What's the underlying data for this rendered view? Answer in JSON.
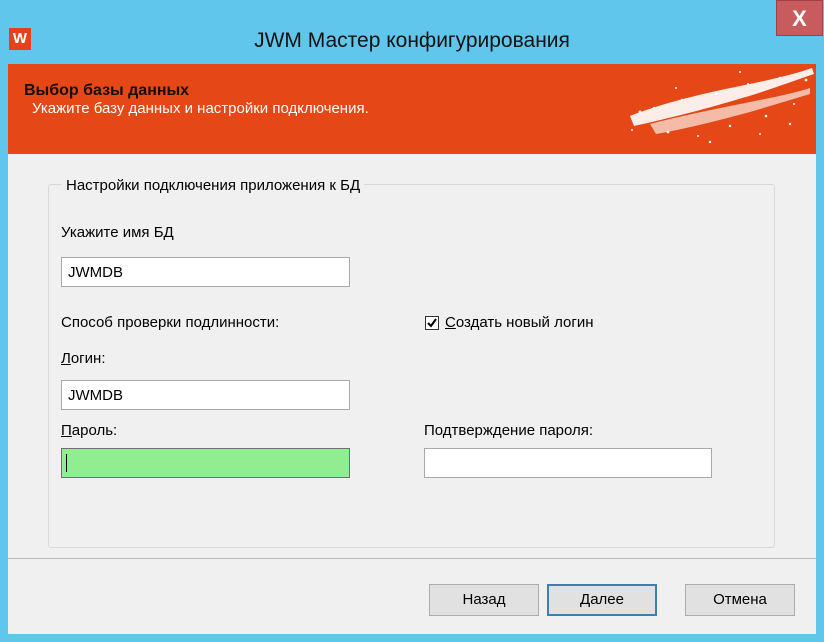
{
  "window": {
    "title": "JWM Мастер конфигурирования",
    "app_icon_letter": "W",
    "close_glyph": "X",
    "accent_color": "#60c6ec",
    "banner_color": "#e54716"
  },
  "banner": {
    "title": "Выбор базы данных",
    "subtitle": "Укажите базу данных и настройки подключения."
  },
  "group": {
    "legend": "Настройки подключения приложения к БД",
    "db_name_label": "Укажите имя БД",
    "db_name_value": "JWMDB",
    "auth_method_label": "Способ проверки подлинности:",
    "create_login_first": "С",
    "create_login_rest": "оздать новый логин",
    "create_login_checked": true,
    "login_label_first": "Л",
    "login_label_rest": "огин:",
    "login_value": "JWMDB",
    "password_label_first": "П",
    "password_label_rest": "ароль:",
    "password_value": "",
    "confirm_password_label": "Подтверждение пароля:",
    "confirm_password_value": ""
  },
  "buttons": {
    "back": "Назад",
    "next_first": "Д",
    "next_rest": "алее",
    "cancel": "Отмена"
  }
}
